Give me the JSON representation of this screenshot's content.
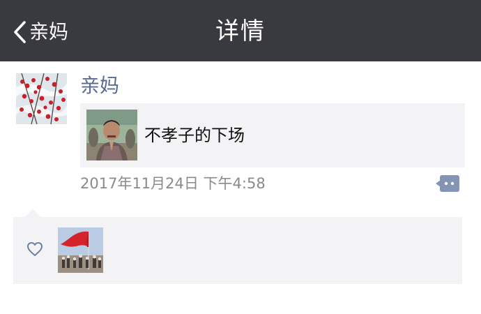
{
  "navbar": {
    "back_label": "亲妈",
    "title": "详情",
    "background": "#393a3f"
  },
  "post": {
    "author": "亲妈",
    "author_color": "#576b95",
    "share": {
      "title": "不孝子的下场"
    },
    "time": "2017年11月24日 下午4:58"
  },
  "icons": {
    "back": "chevron-left-icon",
    "comment": "comment-bubble-icon",
    "like": "heart-outline-icon"
  }
}
